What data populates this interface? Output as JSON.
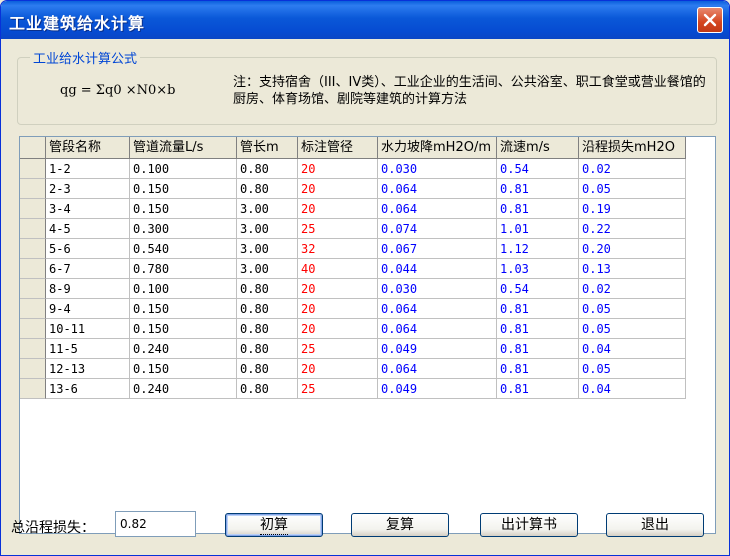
{
  "window": {
    "title": "工业建筑给水计算"
  },
  "formula_group": {
    "legend": "工业给水计算公式",
    "formula": "qg = Σq0 ×N0×b",
    "note": "注：支持宿舍（III、IV类）、工业企业的生活间、公共浴室、职工食堂或营业餐馆的厨房、体育场馆、剧院等建筑的计算方法"
  },
  "table": {
    "columns": [
      "管段名称",
      "管道流量L/s",
      "管长m",
      "标注管径",
      "水力坡降mH2O/m",
      "流速m/s",
      "沿程损失mH2O"
    ],
    "rows": [
      [
        "1-2",
        "0.100",
        "0.80",
        "20",
        "0.030",
        "0.54",
        "0.02"
      ],
      [
        "2-3",
        "0.150",
        "0.80",
        "20",
        "0.064",
        "0.81",
        "0.05"
      ],
      [
        "3-4",
        "0.150",
        "3.00",
        "20",
        "0.064",
        "0.81",
        "0.19"
      ],
      [
        "4-5",
        "0.300",
        "3.00",
        "25",
        "0.074",
        "1.01",
        "0.22"
      ],
      [
        "5-6",
        "0.540",
        "3.00",
        "32",
        "0.067",
        "1.12",
        "0.20"
      ],
      [
        "6-7",
        "0.780",
        "3.00",
        "40",
        "0.044",
        "1.03",
        "0.13"
      ],
      [
        "8-9",
        "0.100",
        "0.80",
        "20",
        "0.030",
        "0.54",
        "0.02"
      ],
      [
        "9-4",
        "0.150",
        "0.80",
        "20",
        "0.064",
        "0.81",
        "0.05"
      ],
      [
        "10-11",
        "0.150",
        "0.80",
        "20",
        "0.064",
        "0.81",
        "0.05"
      ],
      [
        "11-5",
        "0.240",
        "0.80",
        "25",
        "0.049",
        "0.81",
        "0.04"
      ],
      [
        "12-13",
        "0.150",
        "0.80",
        "20",
        "0.064",
        "0.81",
        "0.05"
      ],
      [
        "13-6",
        "0.240",
        "0.80",
        "25",
        "0.049",
        "0.81",
        "0.04"
      ]
    ]
  },
  "footer": {
    "total_label": "总沿程损失：",
    "total_value": "0.82",
    "buttons": {
      "initial": "初算",
      "recheck": "复算",
      "report": "出计算书",
      "exit": "退出"
    }
  },
  "icons": {
    "close": "close-icon"
  },
  "colors": {
    "title_bar": "#0a58d8",
    "close_button": "#d4451f",
    "pipe_diameter_text": "#ff0000",
    "computed_value_text": "#0000ff",
    "group_legend": "#0046d5"
  }
}
